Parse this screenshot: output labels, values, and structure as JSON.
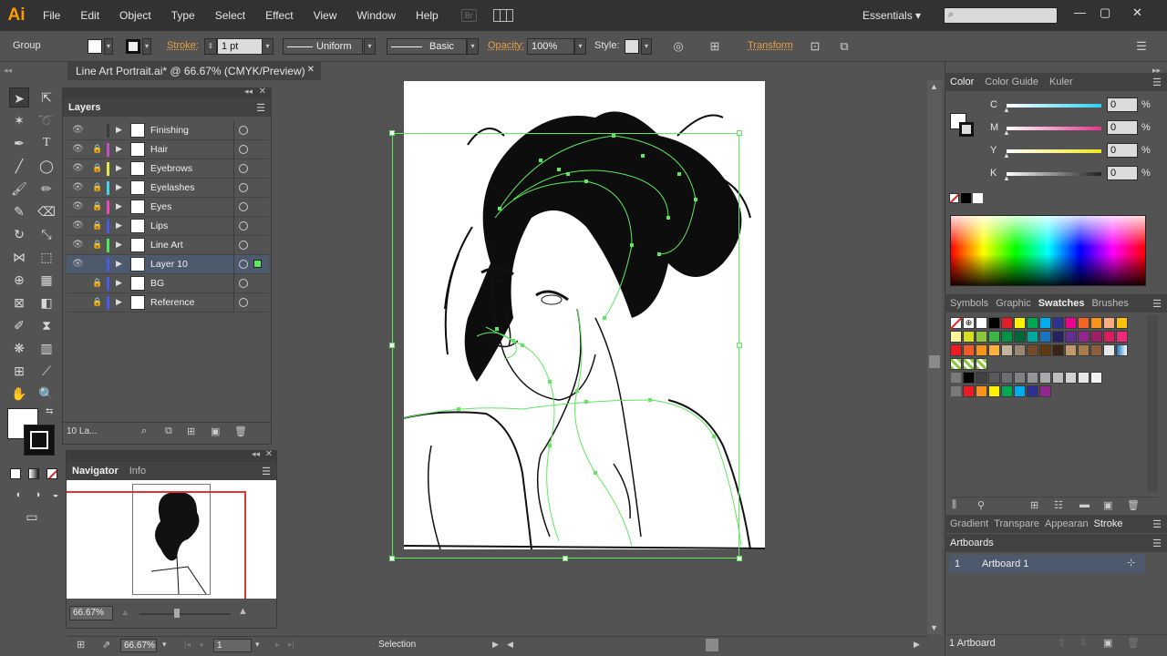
{
  "app": {
    "logo": "Ai",
    "bridge": "Br"
  },
  "menu": [
    "File",
    "Edit",
    "Object",
    "Type",
    "Select",
    "Effect",
    "View",
    "Window",
    "Help"
  ],
  "workspace": "Essentials",
  "window_controls": {
    "minimize": "—",
    "maximize": "▢",
    "close": "✕"
  },
  "control_bar": {
    "selection_type": "Group",
    "stroke_label": "Stroke:",
    "stroke_weight": "1 pt",
    "profile": "Uniform",
    "brush": "Basic",
    "opacity_label": "Opacity:",
    "opacity_value": "100%",
    "style_label": "Style:",
    "transform_label": "Transform"
  },
  "document": {
    "tab_title": "Line Art Portrait.ai* @ 66.67% (CMYK/Preview)",
    "close": "✕"
  },
  "layers_panel": {
    "title": "Layers",
    "layers": [
      {
        "name": "Finishing",
        "color": "#3c3c3c",
        "visible": true,
        "locked": false,
        "selected": false
      },
      {
        "name": "Hair",
        "color": "#c24fc2",
        "visible": true,
        "locked": true,
        "selected": false
      },
      {
        "name": "Eyebrows",
        "color": "#e8e84a",
        "visible": true,
        "locked": true,
        "selected": false
      },
      {
        "name": "Eyelashes",
        "color": "#4acde8",
        "visible": true,
        "locked": true,
        "selected": false
      },
      {
        "name": "Eyes",
        "color": "#e84ab8",
        "visible": true,
        "locked": true,
        "selected": false
      },
      {
        "name": "Lips",
        "color": "#4a5ae8",
        "visible": true,
        "locked": true,
        "selected": false
      },
      {
        "name": "Line Art",
        "color": "#4ae85a",
        "visible": true,
        "locked": true,
        "selected": false
      },
      {
        "name": "Layer 10",
        "color": "#4a5ae8",
        "visible": true,
        "locked": false,
        "selected": true
      },
      {
        "name": "BG",
        "color": "#4a5ae8",
        "visible": false,
        "locked": true,
        "selected": false
      },
      {
        "name": "Reference",
        "color": "#4a5ae8",
        "visible": false,
        "locked": true,
        "selected": false
      }
    ],
    "count_label": "10 La..."
  },
  "navigator_panel": {
    "tabs": [
      "Navigator",
      "Info"
    ],
    "zoom": "66.67%"
  },
  "color_panel": {
    "tabs": [
      "Color",
      "Color Guide",
      "Kuler"
    ],
    "channels": [
      {
        "label": "C",
        "value": "0",
        "unit": "%",
        "color": "#2fd0f0"
      },
      {
        "label": "M",
        "value": "0",
        "unit": "%",
        "color": "#e8318a"
      },
      {
        "label": "Y",
        "value": "0",
        "unit": "%",
        "color": "#f0e820"
      },
      {
        "label": "K",
        "value": "0",
        "unit": "%",
        "color": "#202020"
      }
    ]
  },
  "swatches_panel": {
    "tabs": [
      "Symbols",
      "Graphic",
      "Swatches",
      "Brushes"
    ]
  },
  "stroke_panel": {
    "tabs": [
      "Gradient",
      "Transpare",
      "Appearan",
      "Stroke"
    ]
  },
  "artboards_panel": {
    "title": "Artboards",
    "items": [
      {
        "index": "1",
        "name": "Artboard 1"
      }
    ],
    "footer": "1 Artboard"
  },
  "status": {
    "zoom": "66.67%",
    "artboard": "1",
    "tool": "Selection"
  }
}
